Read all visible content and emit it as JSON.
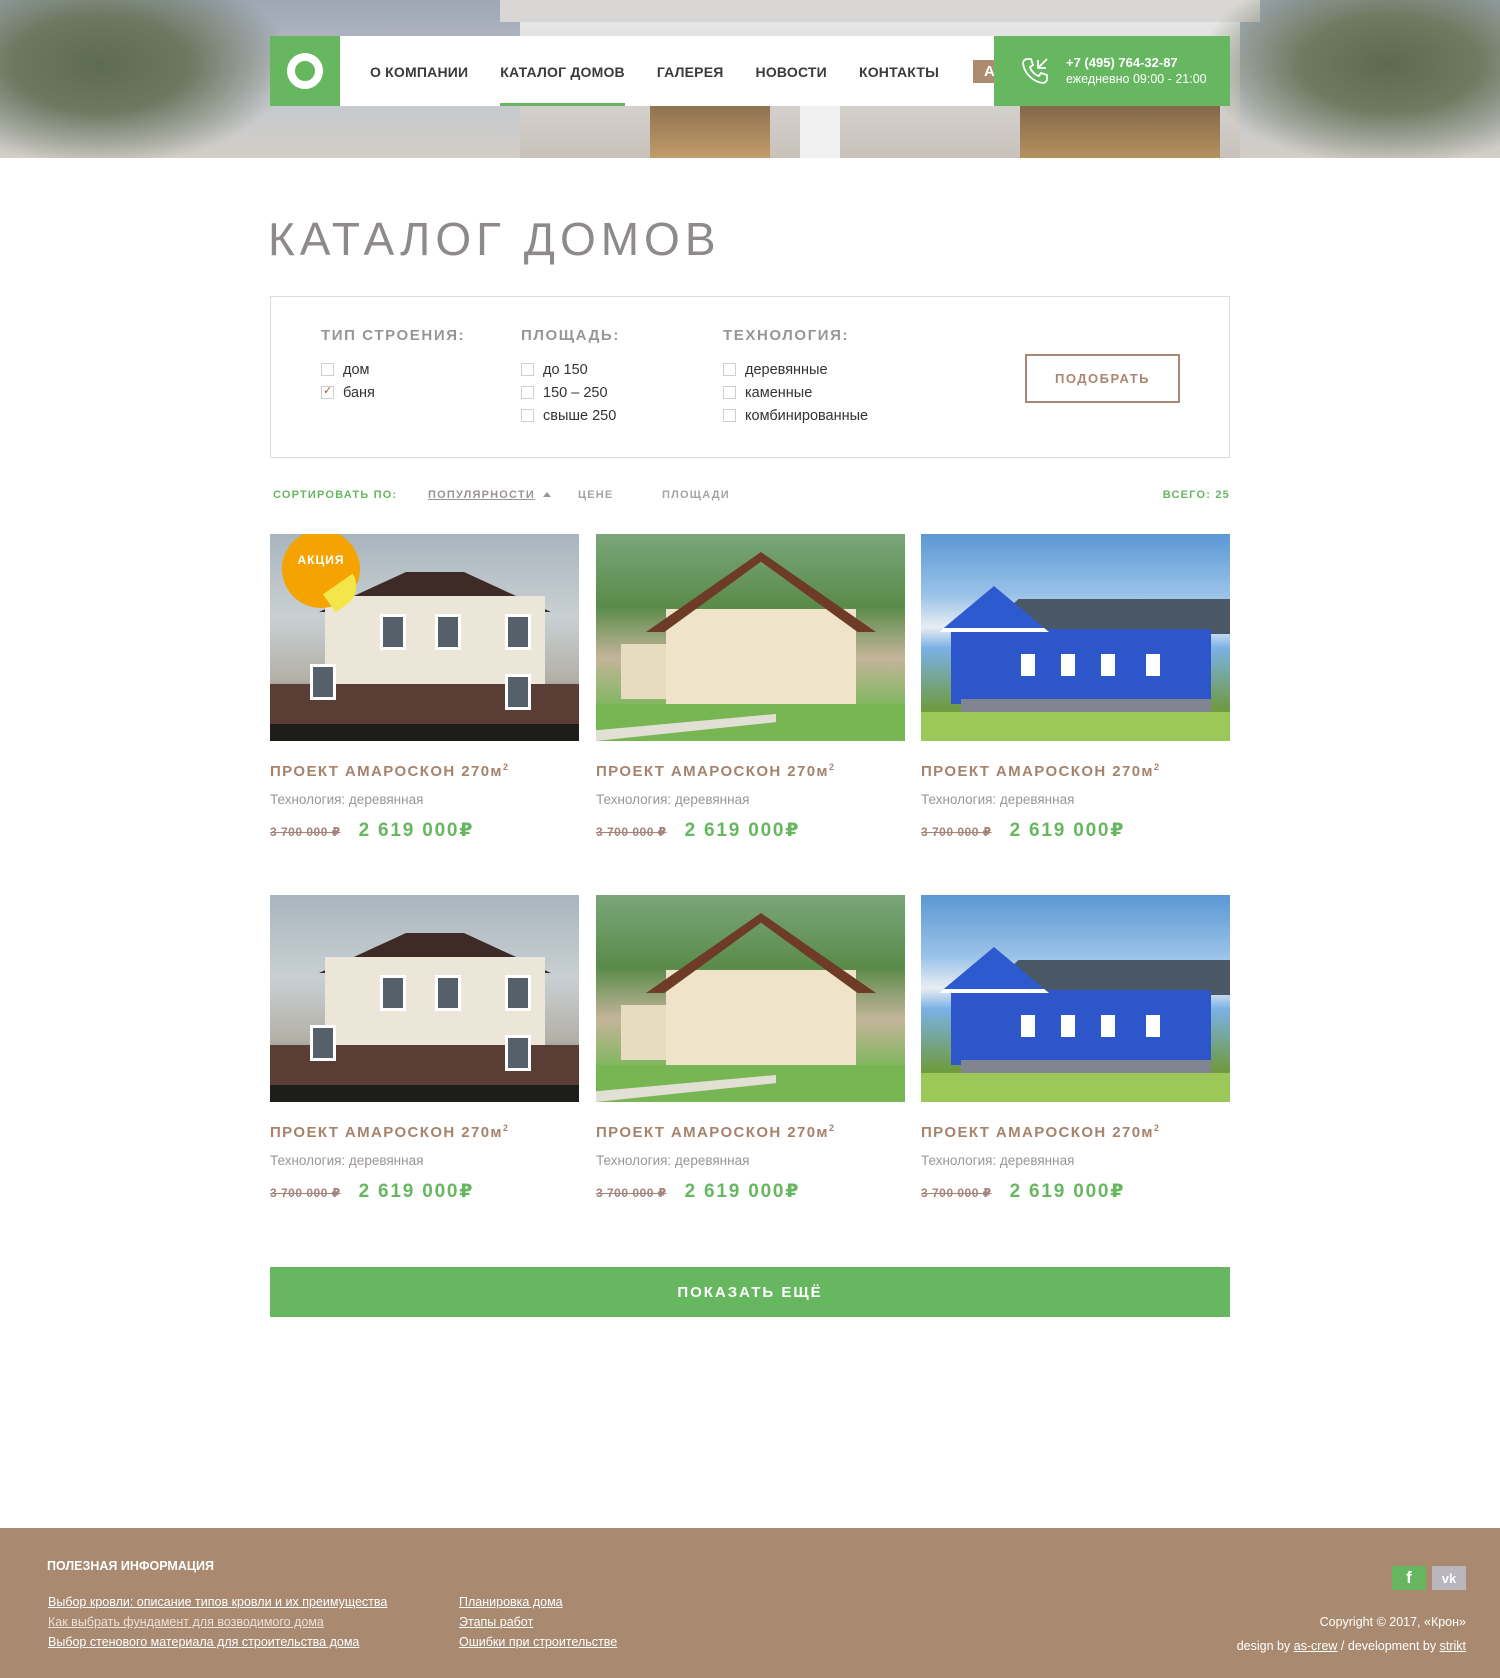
{
  "nav": {
    "items": [
      {
        "label": "О КОМПАНИИ"
      },
      {
        "label": "КАТАЛОГ ДОМОВ"
      },
      {
        "label": "ГАЛЕРЕЯ"
      },
      {
        "label": "НОВОСТИ"
      },
      {
        "label": "КОНТАКТЫ"
      }
    ],
    "active_index": 1,
    "promo_label": "АКЦИИ",
    "phone": "+7 (495) 764-32-87",
    "hours": "ежедневно 09:00 - 21:00",
    "accent_color": "#67b760",
    "promo_color": "#ad8b70"
  },
  "page": {
    "title": "КАТАЛОГ ДОМОВ"
  },
  "filter": {
    "building_type": {
      "title": "ТИП СТРОЕНИЯ:",
      "options": [
        {
          "label": "дом",
          "checked": false
        },
        {
          "label": "баня",
          "checked": true
        }
      ]
    },
    "area": {
      "title": "ПЛОЩАДЬ:",
      "options": [
        {
          "label": "до 150",
          "checked": false
        },
        {
          "label": "150 – 250",
          "checked": false
        },
        {
          "label": "свыше 250",
          "checked": false
        }
      ]
    },
    "technology": {
      "title": "ТЕХНОЛОГИЯ:",
      "options": [
        {
          "label": "деревянные",
          "checked": false
        },
        {
          "label": "каменные",
          "checked": false
        },
        {
          "label": "комбинированные",
          "checked": false
        }
      ]
    },
    "submit_label": "ПОДОБРАТЬ"
  },
  "sort": {
    "label": "СОРТИРОВАТЬ ПО:",
    "options": [
      "ПОПУЛЯРНОСТИ",
      "ЦЕНЕ",
      "ПЛОЩАДИ"
    ],
    "active": "ПОПУЛЯРНОСТИ",
    "total": "ВСЕГО: 25"
  },
  "products": [
    {
      "name": "ПРОЕКТ АМАРОСКОН 270м",
      "sup": "2",
      "tech": "Технология: деревянная",
      "old_price": "3 700 000 ₽",
      "price": "2 619 000₽",
      "badge": "АКЦИЯ",
      "image": "house-brick-two-storey"
    },
    {
      "name": "ПРОЕКТ АМАРОСКОН 270м",
      "sup": "2",
      "tech": "Технология: деревянная",
      "old_price": "3 700 000 ₽",
      "price": "2 619 000₽",
      "image": "house-chalet-garage"
    },
    {
      "name": "ПРОЕКТ АМАРОСКОН 270м",
      "sup": "2",
      "tech": "Технология: деревянная",
      "old_price": "3 700 000 ₽",
      "price": "2 619 000₽",
      "image": "house-blue-wooden"
    },
    {
      "name": "ПРОЕКТ АМАРОСКОН 270м",
      "sup": "2",
      "tech": "Технология: деревянная",
      "old_price": "3 700 000 ₽",
      "price": "2 619 000₽",
      "image": "house-brick-two-storey"
    },
    {
      "name": "ПРОЕКТ АМАРОСКОН 270м",
      "sup": "2",
      "tech": "Технология: деревянная",
      "old_price": "3 700 000 ₽",
      "price": "2 619 000₽",
      "image": "house-chalet-garage"
    },
    {
      "name": "ПРОЕКТ АМАРОСКОН 270м",
      "sup": "2",
      "tech": "Технология: деревянная",
      "old_price": "3 700 000 ₽",
      "price": "2 619 000₽",
      "image": "house-blue-wooden"
    }
  ],
  "show_more_label": "ПОКАЗАТЬ ЕЩЁ",
  "footer": {
    "title": "ПОЛЕЗНАЯ ИНФОРМАЦИЯ",
    "links_col1": [
      "Выбор кровли: описание типов кровли и их преимущества",
      "Как выбрать фундамент для возводимого дома",
      "Выбор стенового материала для строительства дома"
    ],
    "links_col2": [
      "Планировка дома",
      "Этапы работ",
      "Ошибки при строительстве"
    ],
    "social": {
      "facebook": "f",
      "vk": "vk"
    },
    "copyright": "Copyright ©  2017, «Крон»",
    "credit_design_prefix": "design by",
    "credit_design": "as-crew",
    "credit_dev_prefix": " / development by",
    "credit_dev": "strikt",
    "bg_color": "#a98a71"
  }
}
